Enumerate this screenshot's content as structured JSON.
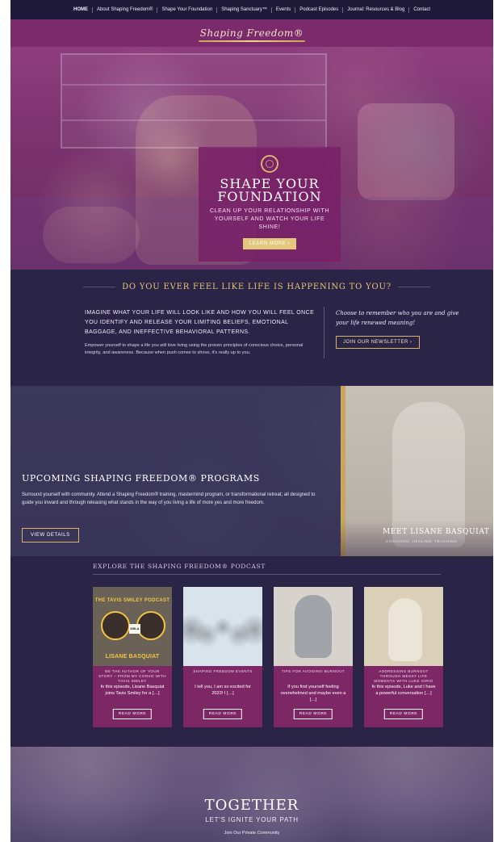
{
  "nav": {
    "items": [
      {
        "label": "HOME",
        "active": true
      },
      {
        "label": "About Shaping Freedom®",
        "active": false
      },
      {
        "label": "Shape Your Foundation",
        "active": false
      },
      {
        "label": "Shaping Sanctuary™",
        "active": false
      },
      {
        "label": "Events",
        "active": false
      },
      {
        "label": "Podcast Episodes",
        "active": false
      },
      {
        "label": "Journal: Resources & Blog",
        "active": false
      },
      {
        "label": "Contact",
        "active": false
      }
    ]
  },
  "brand": {
    "logo_text": "Shaping Freedom®"
  },
  "hero": {
    "title": "Shape Your Foundation",
    "subtitle": "Clean up your relationship with yourself and watch your life shine!",
    "cta": "LEARN MORE ›"
  },
  "intro": {
    "headline": "Do you ever feel like life is happening to you?",
    "caps": "Imagine what your life will look like and how you will feel once you identify and release your limiting beliefs, emotional baggage, and ineffective behavioral patterns.",
    "small": "Empower yourself to shape a life you will love living using the proven principles of conscious choice, personal integrity, and awareness. Because when push comes to shove, it's really up to you.",
    "quote": "Choose to remember who you are and give your life renewed meaning!",
    "newsletter_cta": "JOIN OUR NEWSLETTER ›"
  },
  "programs": {
    "title": "Upcoming Shaping Freedom® Programs",
    "text": "Surround yourself with community. Attend a Shaping Freedom® training, mastermind program, or transformational retreat; all designed to guide you inward and through releasing what stands in the way of you living a life of more yes and more freedom.",
    "cta": "VIEW DETAILS",
    "meet": "Meet Lisane Basquiat",
    "meet_sub": "Coaching, Healing, Teaching"
  },
  "podcast": {
    "heading": "Explore the Shaping Freedom® Podcast",
    "cards": [
      {
        "thumb_title": "THE TAVIS SMILEY PODCAST",
        "thumb_name": "LISANE BASQUIAT",
        "thumb_badge": "KBLA",
        "category": "Be the author of your story – from my Convo with Tavis Smiley",
        "text": "In this episode, Lisane Basquiat joins Tavis Smiley for a […]",
        "cta": "READ MORE"
      },
      {
        "category": "Shaping Freedom Events",
        "text": "I tell you, I am so excited for 2023! I […]",
        "cta": "READ MORE"
      },
      {
        "category": "Tips for avoiding burnout",
        "text": "If you find yourself feeling overwhelmed and maybe even a […]",
        "cta": "READ MORE"
      },
      {
        "category": "Addressing burnout through messy life moments with Luke Iorio",
        "text": "In this episode, Luke and I have a powerful conversation […]",
        "cta": "READ MORE"
      }
    ]
  },
  "together": {
    "title": "TOGETHER",
    "subtitle": "Let's Ignite Your Path",
    "small": "Join Our Private Community"
  }
}
